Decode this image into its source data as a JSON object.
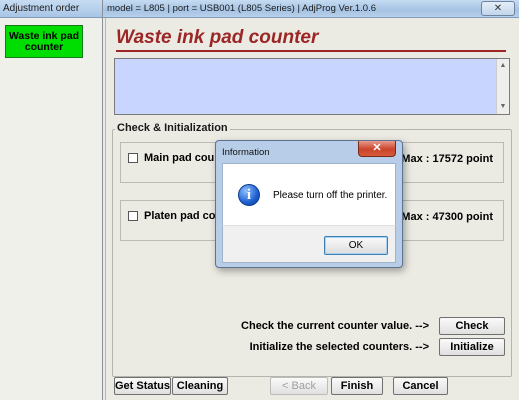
{
  "left_window": {
    "title": "Adjustment order",
    "menu_items": [
      {
        "label": "Waste ink pad\ncounter",
        "active": true,
        "color": "#00dd00"
      }
    ]
  },
  "main_window": {
    "title": "model = L805 | port = USB001 (L805 Series) | AdjProg Ver.1.0.6",
    "close_glyph": "✕",
    "page_title": "Waste ink pad counter",
    "info_panel_text": "",
    "group_title": "Check & Initialization",
    "counters": [
      {
        "label": "Main pad coun",
        "max_text": "Max : 17572 point",
        "checked": false
      },
      {
        "label": "Platen pad cou",
        "max_text": "Max : 47300 point",
        "checked": false
      }
    ],
    "actions": {
      "check_text": "Check the current counter value.  -->",
      "check_button": "Check",
      "init_text": "Initialize the selected counters.  -->",
      "init_button": "Initialize"
    },
    "bottom_buttons": {
      "get_status": "Get Status",
      "cleaning": "Cleaning",
      "back": "< Back",
      "finish": "Finish",
      "cancel": "Cancel"
    }
  },
  "dialog": {
    "title": "Information",
    "close_glyph": "✕",
    "icon": "info-icon",
    "icon_glyph": "i",
    "message": "Please turn off the printer.",
    "ok_label": "OK"
  },
  "colors": {
    "title_red": "#9b2626",
    "info_panel_bg": "#c8d6ff",
    "menu_green": "#00dd00"
  }
}
